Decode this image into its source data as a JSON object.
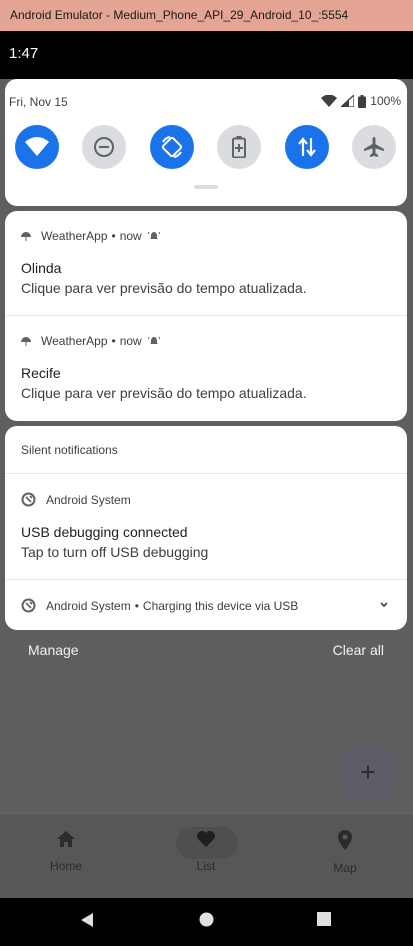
{
  "window": {
    "title": "Android Emulator - Medium_Phone_API_29_Android_10_:5554"
  },
  "status_bar": {
    "time": "1:47"
  },
  "quick_settings": {
    "date": "Fri, Nov 15",
    "battery": "100%",
    "tiles": [
      {
        "name": "wifi",
        "active": true
      },
      {
        "name": "do-not-disturb",
        "active": false
      },
      {
        "name": "auto-rotate",
        "active": true
      },
      {
        "name": "battery-saver",
        "active": false
      },
      {
        "name": "mobile-data",
        "active": true
      },
      {
        "name": "airplane-mode",
        "active": false
      }
    ]
  },
  "notifications": [
    {
      "app": "WeatherApp",
      "time": "now",
      "title": "Olinda",
      "text": "Clique para ver previsão do tempo atualizada."
    },
    {
      "app": "WeatherApp",
      "time": "now",
      "title": "Recife",
      "text": "Clique para ver previsão do tempo atualizada."
    }
  ],
  "silent": {
    "header": "Silent notifications",
    "usb": {
      "app": "Android System",
      "title": "USB debugging connected",
      "text": "Tap to turn off USB debugging"
    },
    "charging": {
      "app": "Android System",
      "text": "Charging this device via USB"
    }
  },
  "actions": {
    "manage": "Manage",
    "clear_all": "Clear all"
  },
  "fab": {
    "label": "+"
  },
  "bottom_nav": [
    {
      "label": "Home",
      "icon": "home-icon"
    },
    {
      "label": "List",
      "icon": "heart-icon"
    },
    {
      "label": "Map",
      "icon": "map-pin-icon"
    }
  ],
  "colors": {
    "accent": "#1a73e8",
    "titlebar": "#e5a595",
    "scrim": "#5f5f5f"
  }
}
